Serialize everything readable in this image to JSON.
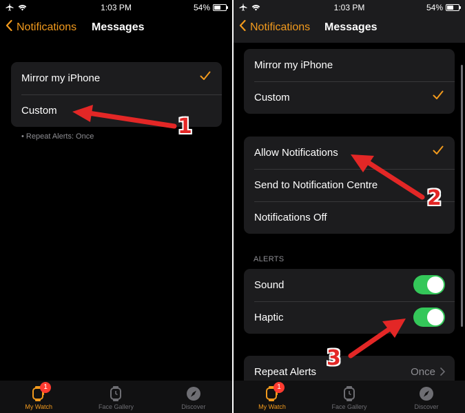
{
  "status_bar": {
    "time": "1:03 PM",
    "battery": "54%",
    "battery_level": 0.54
  },
  "nav": {
    "back_label": "Notifications",
    "title": "Messages"
  },
  "left": {
    "options": [
      {
        "label": "Mirror my iPhone",
        "checked": true
      },
      {
        "label": "Custom",
        "checked": false
      }
    ],
    "footnote": "• Repeat Alerts: Once"
  },
  "right": {
    "mode_options": [
      {
        "label": "Mirror my iPhone",
        "checked": false
      },
      {
        "label": "Custom",
        "checked": true
      }
    ],
    "notification_options": [
      {
        "label": "Allow Notifications",
        "checked": true
      },
      {
        "label": "Send to Notification Centre",
        "checked": false
      },
      {
        "label": "Notifications Off",
        "checked": false
      }
    ],
    "alerts_header": "ALERTS",
    "alerts": [
      {
        "label": "Sound",
        "on": true
      },
      {
        "label": "Haptic",
        "on": true
      }
    ],
    "repeat_alerts": {
      "label": "Repeat Alerts",
      "value": "Once"
    }
  },
  "tab_bar": {
    "tabs": [
      {
        "label": "My Watch",
        "active": true,
        "badge": "1",
        "icon": "watch-icon"
      },
      {
        "label": "Face Gallery",
        "active": false,
        "icon": "watch-face-icon"
      },
      {
        "label": "Discover",
        "active": false,
        "icon": "compass-icon"
      }
    ]
  },
  "annotations": [
    "1",
    "2",
    "3"
  ],
  "colors": {
    "accent": "#f29a1d",
    "toggle_on": "#34c759",
    "annotation": "#e32726",
    "badge": "#ff3b30",
    "cell_bg": "#1c1c1e"
  }
}
